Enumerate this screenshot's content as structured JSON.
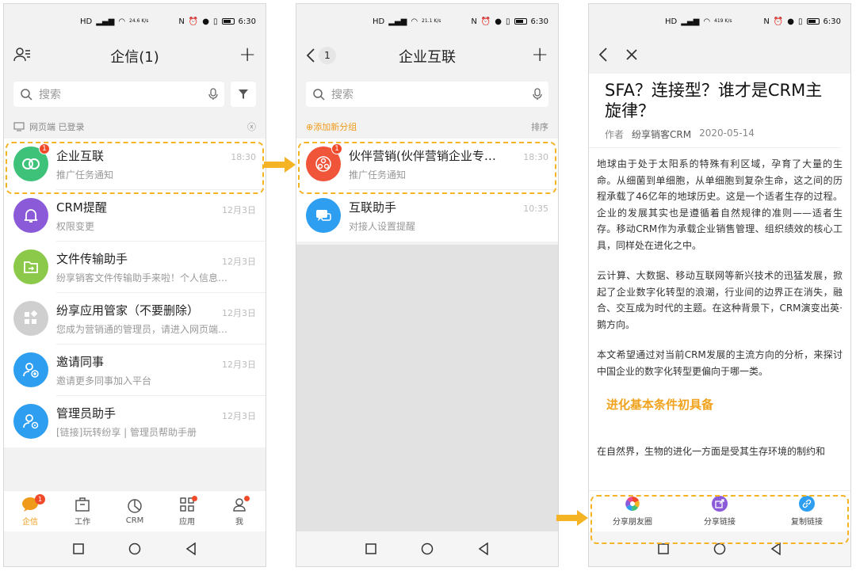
{
  "status": {
    "time": "6:30",
    "speeds": [
      "24.6 K/s",
      "21.1 K/s",
      "419 K/s"
    ]
  },
  "screen1": {
    "title": "企信(1)",
    "search_placeholder": "搜索",
    "web_login_notice": "网页端 已登录",
    "items": [
      {
        "title": "企业互联",
        "subtitle": "推广任务通知",
        "time": "18:30",
        "badge": "1",
        "color": "#3ec27a"
      },
      {
        "title": "CRM提醒",
        "subtitle": "权限变更",
        "time": "12月3日",
        "color": "#8a5ad8"
      },
      {
        "title": "文件传输助手",
        "subtitle": "纷享销客文件传输助手来啦！个人信息…",
        "time": "12月3日",
        "color": "#8cc94a"
      },
      {
        "title": "纷享应用管家（不要删除）",
        "subtitle": "您成为营销通的管理员，请进入网页端…",
        "time": "12月3日",
        "color": "#cfcfcf"
      },
      {
        "title": "邀请同事",
        "subtitle": "邀请更多同事加入平台",
        "time": "12月3日",
        "color": "#2e9ef0"
      },
      {
        "title": "管理员助手",
        "subtitle": "[链接]玩转纷享 | 管理员帮助手册",
        "time": "12月3日",
        "color": "#2e9ef0"
      }
    ],
    "tabs": [
      {
        "label": "企信",
        "badge": "1"
      },
      {
        "label": "工作"
      },
      {
        "label": "CRM"
      },
      {
        "label": "应用"
      },
      {
        "label": "我"
      }
    ]
  },
  "screen2": {
    "title": "企业互联",
    "back_count": "1",
    "search_placeholder": "搜索",
    "add_group": "添加新分组",
    "sort": "排序",
    "items": [
      {
        "title": "伙伴营销(伙伴营销企业专…",
        "subtitle": "推广任务通知",
        "time": "18:30",
        "badge": "1",
        "color": "#f0553a"
      },
      {
        "title": "互联助手",
        "subtitle": "对接人设置提醒",
        "time": "10:35",
        "color": "#2e9ef0"
      }
    ]
  },
  "screen3": {
    "title": "SFA？连接型？谁才是CRM主旋律？",
    "author_label": "作者",
    "author": "纷享销客CRM",
    "date": "2020-05-14",
    "para1": "地球由于处于太阳系的特殊有利区域，孕育了大量的生命。从细菌到单细胞，从单细胞到复杂生命，这之间的历程承载了46亿年的地球历史。这是一个适者生存的过程。企业的发展其实也是遵循着自然规律的准则——适者生存。移动CRM作为承载企业销售管理、组织绩效的核心工具，同样处在进化之中。",
    "para2": "云计算、大数据、移动互联网等新兴技术的迅猛发展，掀起了企业数字化转型的浪潮，行业间的边界正在消失，融合、交互成为时代的主题。在这种背景下，CRM演变出英·鹅方向。",
    "para3": "本文希望通过对当前CRM发展的主流方向的分析，来探讨中国企业的数字化转型更偏向于哪一类。",
    "heading": "进化基本条件初具备",
    "para4": "在自然界，生物的进化一方面是受其生存环境的制约和",
    "share": [
      {
        "label": "分享朋友圈"
      },
      {
        "label": "分享链接"
      },
      {
        "label": "复制链接"
      }
    ]
  }
}
